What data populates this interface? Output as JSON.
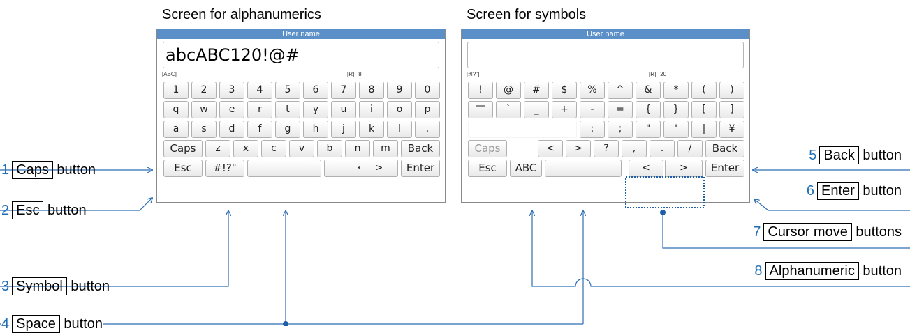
{
  "left_screen": {
    "caption": "Screen for alphanumerics",
    "title": "User name",
    "input_value": "abcABC120!@#",
    "mode_label": "[ABC]",
    "r_label": "[R]",
    "r_count": "8",
    "rows": [
      [
        "1",
        "2",
        "3",
        "4",
        "5",
        "6",
        "7",
        "8",
        "9",
        "0"
      ],
      [
        "q",
        "w",
        "e",
        "r",
        "t",
        "y",
        "u",
        "i",
        "o",
        "p"
      ],
      [
        "a",
        "s",
        "d",
        "f",
        "g",
        "h",
        "j",
        "k",
        "l",
        "."
      ],
      [
        "Caps",
        "z",
        "x",
        "c",
        "v",
        "b",
        "n",
        "m",
        "Back"
      ],
      [
        "Esc",
        "#!?\"",
        "",
        "<",
        ">",
        "Enter"
      ]
    ]
  },
  "right_screen": {
    "caption": "Screen for symbols",
    "title": "User name",
    "input_value": "",
    "mode_label": "[#!?\"]",
    "r_label": "[R]",
    "r_count": "20",
    "rows": [
      [
        "!",
        "@",
        "#",
        "$",
        "%",
        "^",
        "&",
        "*",
        "(",
        ")"
      ],
      [
        "—",
        "`",
        "_",
        "+",
        "-",
        "=",
        "{",
        "}",
        "[",
        "]"
      ],
      [
        "",
        ":",
        ";",
        "\"",
        "'",
        "|",
        "¥"
      ],
      [
        "Caps",
        "<",
        ">",
        "?",
        ",",
        ".",
        "/",
        "Back"
      ],
      [
        "Esc",
        "ABC",
        "",
        "<",
        ">",
        "Enter"
      ]
    ]
  },
  "callouts": {
    "c1": {
      "num": "1",
      "label": "Caps",
      "suffix": "button"
    },
    "c2": {
      "num": "2",
      "label": "Esc",
      "suffix": "button"
    },
    "c3": {
      "num": "3",
      "label": "Symbol",
      "suffix": "button"
    },
    "c4": {
      "num": "4",
      "label": "Space",
      "suffix": "button"
    },
    "c5": {
      "num": "5",
      "label": "Back",
      "suffix": "button"
    },
    "c6": {
      "num": "6",
      "label": "Enter",
      "suffix": "button"
    },
    "c7": {
      "num": "7",
      "label": "Cursor move",
      "suffix": "buttons"
    },
    "c8": {
      "num": "8",
      "label": "Alphanumeric",
      "suffix": "button"
    }
  },
  "colors": {
    "number": "#1f6db5",
    "line": "#2e6db4",
    "titlebar": "#5b8fc7"
  }
}
